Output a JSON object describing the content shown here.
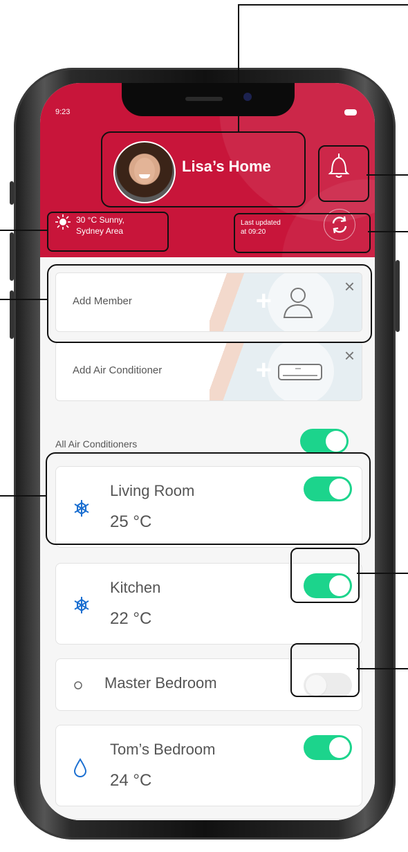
{
  "status_bar": {
    "time": "9:23"
  },
  "header": {
    "title": "Lisa’s Home",
    "weather_line1": "30 °C Sunny,",
    "weather_line2": "Sydney Area",
    "updated_line1": "Last updated",
    "updated_line2": "at 09:20"
  },
  "actions": [
    {
      "label": "Add Member",
      "icon": "person-icon"
    },
    {
      "label": "Add Air Conditioner",
      "icon": "air-conditioner-icon"
    }
  ],
  "all_toggle": {
    "label": "All Air Conditioners",
    "on": true
  },
  "rooms": [
    {
      "name": "Living Room",
      "temp": "25 °C",
      "mode": "snowflake-icon",
      "on": true
    },
    {
      "name": "Kitchen",
      "temp": "22 °C",
      "mode": "snowflake-icon",
      "on": true
    },
    {
      "name": "Master Bedroom",
      "temp": "",
      "mode": "circle-icon",
      "on": false
    },
    {
      "name": "Tom’s Bedroom",
      "temp": "24 °C",
      "mode": "droplet-icon",
      "on": true
    }
  ],
  "colors": {
    "brand": "#c8153a",
    "toggle_on": "#1cd48c",
    "icon_blue": "#1b6fd1"
  }
}
